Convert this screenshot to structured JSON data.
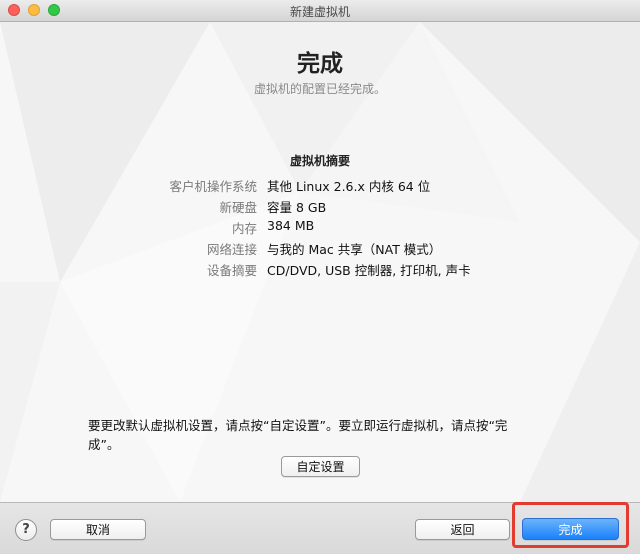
{
  "window": {
    "title": "新建虚拟机"
  },
  "header": {
    "title": "完成",
    "subtitle": "虚拟机的配置已经完成。"
  },
  "summary": {
    "title": "虚拟机摘要",
    "rows": [
      {
        "label": "客户机操作系统",
        "value": "其他 Linux 2.6.x 内核 64 位"
      },
      {
        "label": "新硬盘",
        "value": "容量 8 GB"
      },
      {
        "label": "内存",
        "value": "384 MB"
      },
      {
        "label": "网络连接",
        "value": "与我的 Mac 共享（NAT 模式）"
      },
      {
        "label": "设备摘要",
        "value": "CD/DVD, USB 控制器, 打印机, 声卡"
      }
    ]
  },
  "hint": "要更改默认虚拟机设置，请点按“自定设置”。要立即运行虚拟机，请点按“完成”。",
  "buttons": {
    "customize": "自定设置",
    "help": "?",
    "cancel": "取消",
    "back": "返回",
    "done": "完成"
  },
  "colors": {
    "done_button": "#1a82fb",
    "highlight": "#e23b2f"
  }
}
